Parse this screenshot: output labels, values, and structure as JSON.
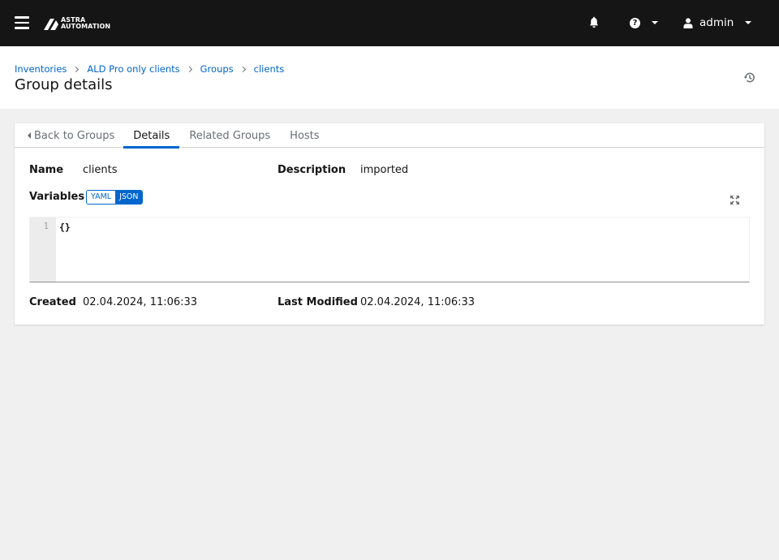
{
  "masthead": {
    "logo_line1": "ASTRA",
    "logo_line2": "AUTOMATION",
    "help_icon": "?",
    "user_name": "admin"
  },
  "breadcrumb": [
    "Inventories",
    "ALD Pro only clients",
    "Groups",
    "clients"
  ],
  "page_title": "Group details",
  "tabs": {
    "back": "Back to Groups",
    "details": "Details",
    "related": "Related Groups",
    "hosts": "Hosts",
    "active": "Details"
  },
  "details": {
    "name_label": "Name",
    "name_value": "clients",
    "description_label": "Description",
    "description_value": "imported",
    "variables_label": "Variables",
    "toggle_yaml": "YAML",
    "toggle_json": "JSON",
    "toggle_selected": "JSON",
    "editor_line_number": "1",
    "editor_content": "{}",
    "created_label": "Created",
    "created_value": "02.04.2024, 11:06:33",
    "modified_label": "Last Modified",
    "modified_value": "02.04.2024, 11:06:33"
  },
  "icons": [
    "hamburger-icon",
    "bell-icon",
    "help-icon",
    "user-icon",
    "history-icon",
    "expand-icon",
    "chevron-right-icon",
    "caret-down-icon",
    "caret-left-icon"
  ],
  "colors": {
    "masthead_bg": "#151515",
    "link": "#0066cc",
    "active_tab": "#0066cc",
    "page_bg": "#f0f0f0"
  }
}
